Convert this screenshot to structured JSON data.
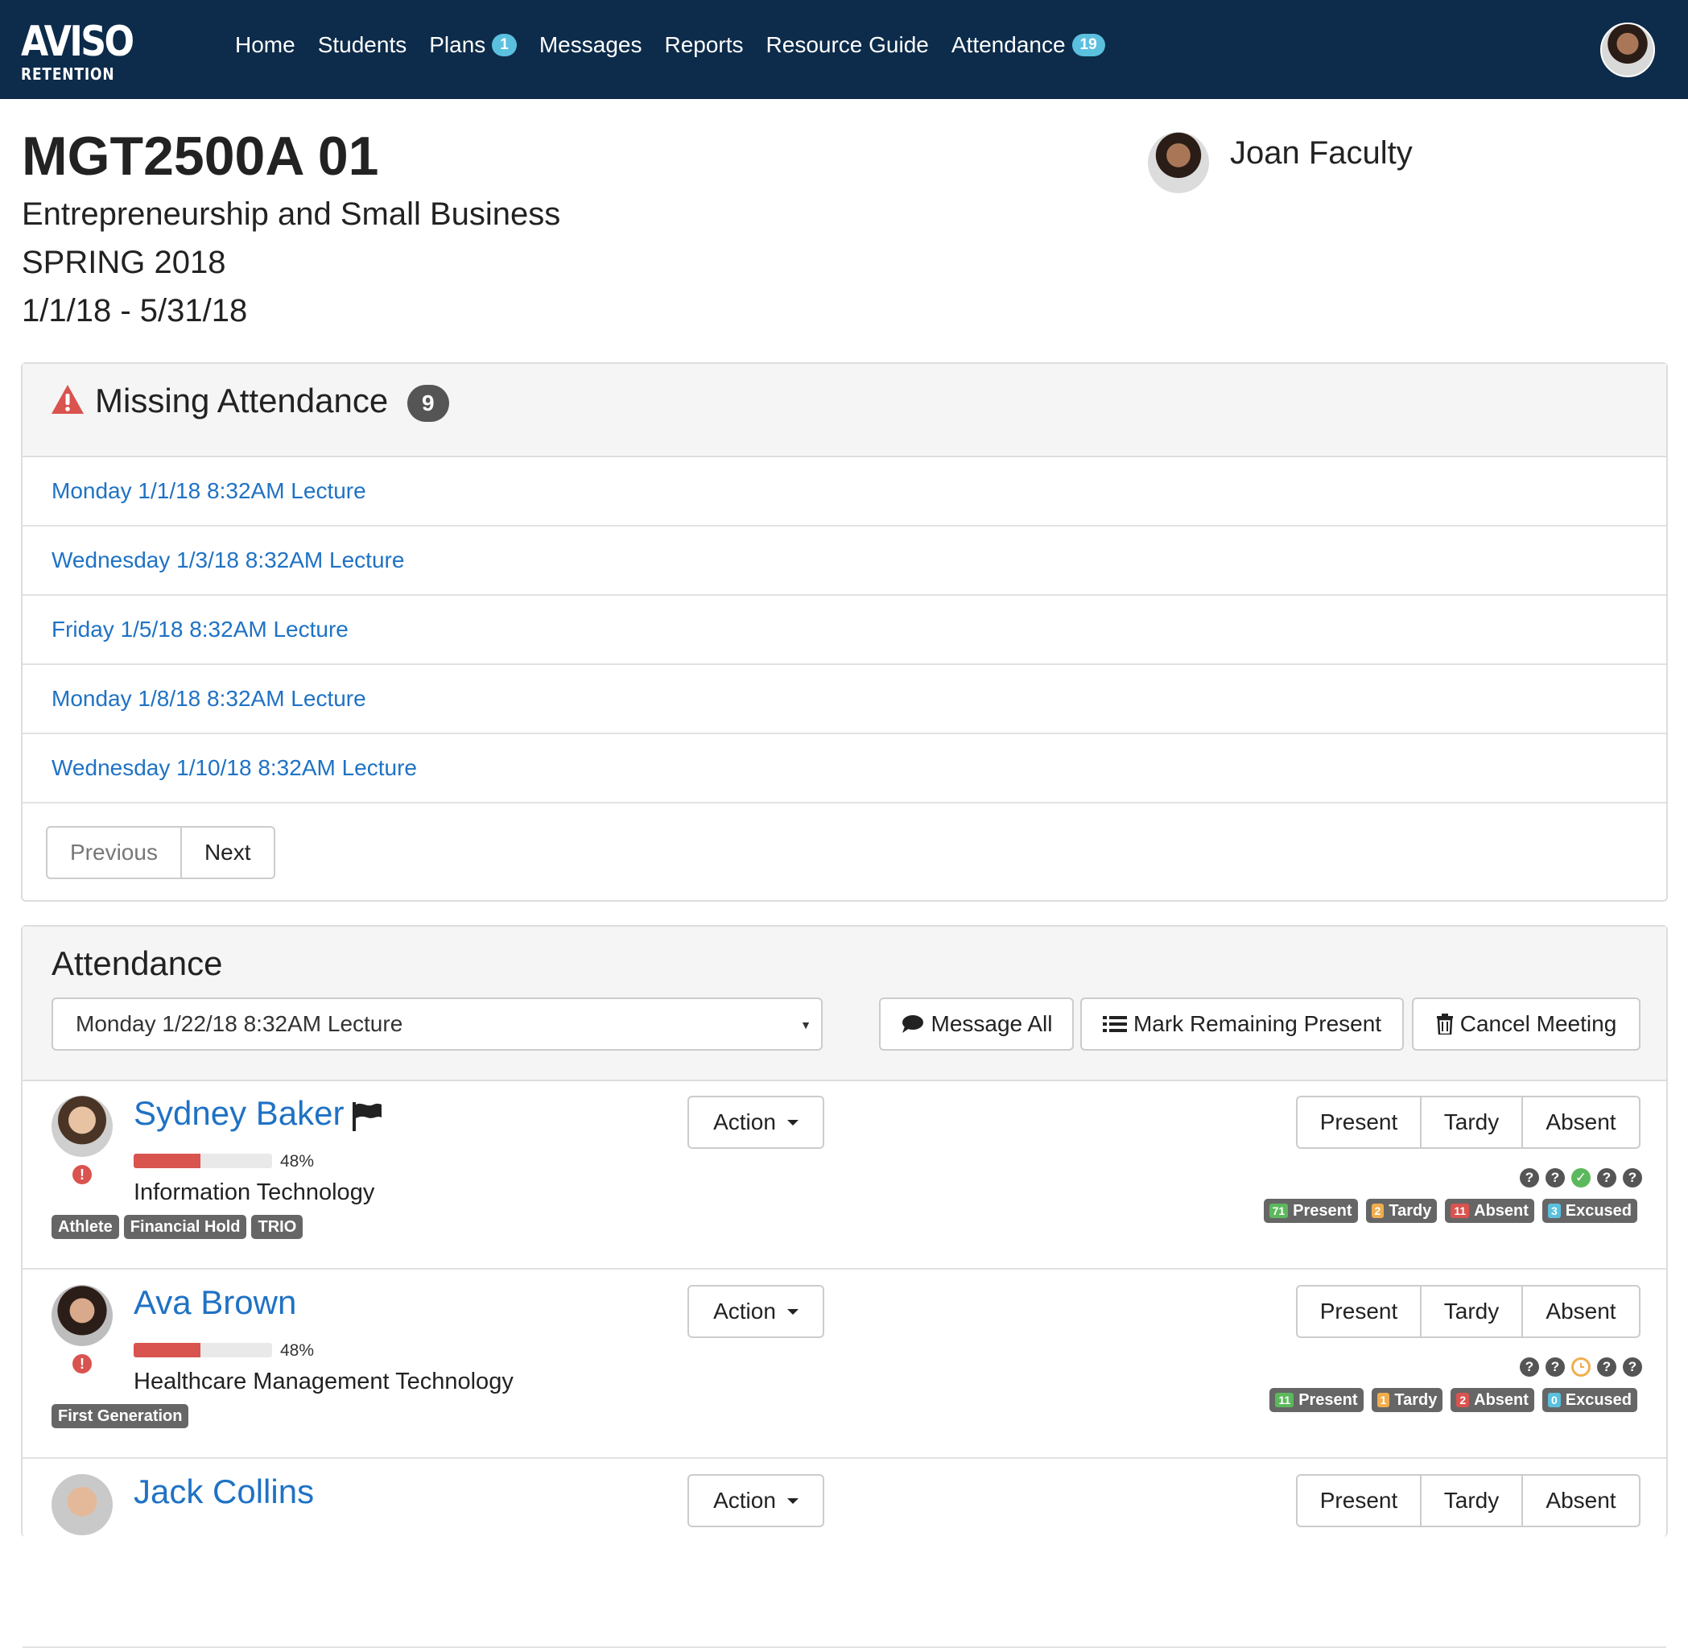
{
  "app": {
    "logo_line1": "AVISO",
    "logo_line2": "RETENTION"
  },
  "nav": {
    "home": "Home",
    "students": "Students",
    "plans": "Plans",
    "plans_badge": "1",
    "messages": "Messages",
    "reports": "Reports",
    "resource_guide": "Resource Guide",
    "attendance": "Attendance",
    "attendance_badge": "19"
  },
  "course": {
    "code": "MGT2500A 01",
    "name": "Entrepreneurship and Small Business",
    "term": "SPRING 2018",
    "dates": "1/1/18 - 5/31/18",
    "faculty": "Joan Faculty"
  },
  "missing": {
    "title": "Missing Attendance",
    "count": "9",
    "items": [
      "Monday 1/1/18 8:32AM Lecture",
      "Wednesday 1/3/18 8:32AM Lecture",
      "Friday 1/5/18 8:32AM Lecture",
      "Monday 1/8/18 8:32AM Lecture",
      "Wednesday 1/10/18 8:32AM Lecture"
    ],
    "previous": "Previous",
    "next": "Next"
  },
  "attendance": {
    "title": "Attendance",
    "selected_meeting": "Monday 1/22/18 8:32AM Lecture",
    "message_all": "Message All",
    "mark_remaining": "Mark Remaining Present",
    "cancel_meeting": "Cancel Meeting",
    "action_label": "Action",
    "present_label": "Present",
    "tardy_label": "Tardy",
    "absent_label": "Absent",
    "excused_label": "Excused"
  },
  "students": [
    {
      "name": "Sydney Baker",
      "progress": 48,
      "progress_label": "48%",
      "major": "Information Technology",
      "tags": [
        "Athlete",
        "Financial Hold",
        "TRIO"
      ],
      "history": [
        "unknown",
        "unknown",
        "present",
        "unknown",
        "unknown"
      ],
      "counts": {
        "present": "71",
        "tardy": "2",
        "absent": "11",
        "excused": "3"
      }
    },
    {
      "name": "Ava Brown",
      "progress": 48,
      "progress_label": "48%",
      "major": "Healthcare Management Technology",
      "tags": [
        "First Generation"
      ],
      "history": [
        "unknown",
        "unknown",
        "tardy",
        "unknown",
        "unknown"
      ],
      "counts": {
        "present": "11",
        "tardy": "1",
        "absent": "2",
        "excused": "0"
      }
    },
    {
      "name": "Jack Collins"
    }
  ],
  "colors": {
    "navbar": "#0d2b4a",
    "link": "#1f72c4",
    "badge_info": "#5bc0de",
    "danger": "#d9534f",
    "success": "#5cb85c",
    "warning": "#f0ad4e"
  }
}
